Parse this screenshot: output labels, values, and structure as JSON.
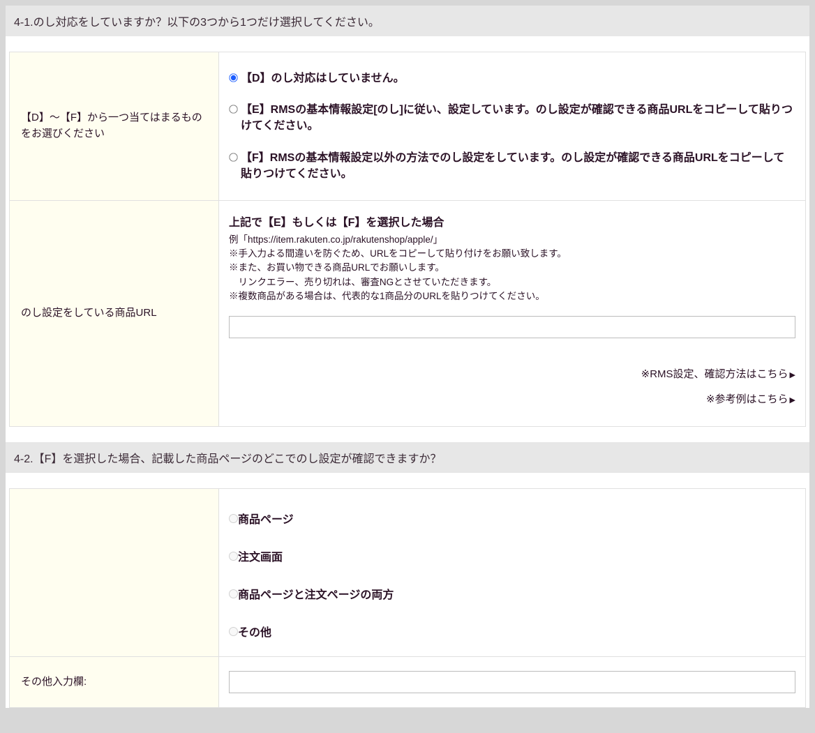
{
  "sections": {
    "s41": {
      "header": "4-1.のし対応をしていますか？以下の3つから1つだけ選択してください。",
      "labelCellA": "【D】〜【F】から一つ当てはまるものをお選びください",
      "radios": {
        "D": "【D】のし対応はしていません。",
        "E": "【E】RMSの基本情報設定[のし]に従い、設定しています。のし設定が確認できる商品URLをコピーして貼りつけてください。",
        "F": "【F】RMSの基本情報設定以外の方法でのし設定をしています。のし設定が確認できる商品URLをコピーして貼りつけてください。"
      },
      "labelCellB": "のし設定をしている商品URL",
      "descTitle": "上記で【E】もしくは【F】を選択した場合",
      "descLine1": "例「https://item.rakuten.co.jp/rakutenshop/apple/」",
      "descLine2": "※手入力よる間違いを防ぐため、URLをコピーして貼り付けをお願い致します。",
      "descLine3": "※また、お買い物できる商品URLでお願いします。",
      "descLine4": "　リンクエラー、売り切れは、審査NGとさせていただきます。",
      "descLine5": "※複数商品がある場合は、代表的な1商品分のURLを貼りつけてください。",
      "urlValue": "",
      "link1": "※RMS設定、確認方法はこちら",
      "link2": "※参考例はこちら"
    },
    "s42": {
      "header": "4-2.【F】を選択した場合、記載した商品ページのどこでのし設定が確認できますか？",
      "radios": {
        "r1": "商品ページ",
        "r2": "注文画面",
        "r3": "商品ページと注文ページの両方",
        "r4": "その他"
      },
      "otherLabel": "その他入力欄:",
      "otherValue": ""
    }
  }
}
